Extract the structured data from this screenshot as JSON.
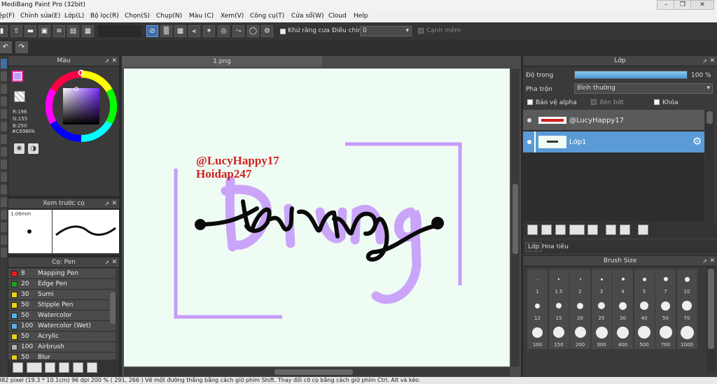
{
  "window": {
    "title": "MediBang Paint Pro (32bit)"
  },
  "menu": [
    "Tệp(F)",
    "Chỉnh sửa(E)",
    "Lớp(L)",
    "Bộ lọc(R)",
    "Chọn(S)",
    "Chụp(N)",
    "Màu (C)",
    "Xem(V)",
    "Công cụ(T)",
    "Cửa sổ(W)",
    "Cloud",
    "Help"
  ],
  "toolbar": {
    "antialias_label": "Khử răng cưa",
    "adjust_label": "Điều chỉnh",
    "adjust_value": "0",
    "edge_label": "Cạnh mềm"
  },
  "color_panel": {
    "title": "Màu",
    "r": "R:198",
    "g": "G:155",
    "b": "B:250",
    "hex": "#C69BFA",
    "current_color": "#C69BFA"
  },
  "preview_panel": {
    "title": "Xem trước cọ",
    "size": "1.06mm"
  },
  "brush_panel": {
    "title": "Cọ: Pen",
    "items": [
      {
        "color": "#e02020",
        "size": "8",
        "name": "Mapping Pen"
      },
      {
        "color": "#20a020",
        "size": "20",
        "name": "Edge Pen"
      },
      {
        "color": "#e8d020",
        "size": "30",
        "name": "Sumi"
      },
      {
        "color": "#e8d020",
        "size": "50",
        "name": "Stipple Pen"
      },
      {
        "color": "#5ab0e0",
        "size": "50",
        "name": "Watercolor"
      },
      {
        "color": "#5ab0e0",
        "size": "100",
        "name": "Watercolor (Wet)"
      },
      {
        "color": "#e8d020",
        "size": "50",
        "name": "Acrylic"
      },
      {
        "color": "#b0b0b0",
        "size": "100",
        "name": "Airbrush"
      },
      {
        "color": "#e8d020",
        "size": "50",
        "name": "Blur"
      }
    ]
  },
  "document": {
    "tab": "1.png",
    "text_line1": "@LucyHappy17",
    "text_line2": "Hoidap247"
  },
  "layer_panel": {
    "title": "Lớp",
    "opacity_label": "Độ trong",
    "opacity_value": "100 %",
    "opacity": 1.0,
    "blend_label": "Pha trộn",
    "blend_value": "Bình thường",
    "alpha_label": "Bảo vệ alpha",
    "clip_label": "Xén bớt",
    "lock_label": "Khóa",
    "layers": [
      {
        "name": "@LucyHappy17"
      },
      {
        "name": "Lớp1"
      }
    ],
    "tabs": [
      "Lớp",
      "Hoa tiêu"
    ]
  },
  "brush_size_panel": {
    "title": "Brush Size",
    "sizes": [
      "1",
      "1.5",
      "2",
      "3",
      "4",
      "5",
      "7",
      "10",
      "12",
      "15",
      "20",
      "25",
      "30",
      "40",
      "50",
      "70",
      "100",
      "150",
      "200",
      "300",
      "400",
      "500",
      "700",
      "1000"
    ]
  },
  "status": {
    "text": "2382 pixel  (19.3 * 10.1cm)  96 dpi  200 %  ( 291, 266 )  Vẽ một đường thẳng bằng cách giữ phím Shift. Thay đổi cỡ cọ bằng cách giữ phím Ctrl, Alt và kéo."
  }
}
